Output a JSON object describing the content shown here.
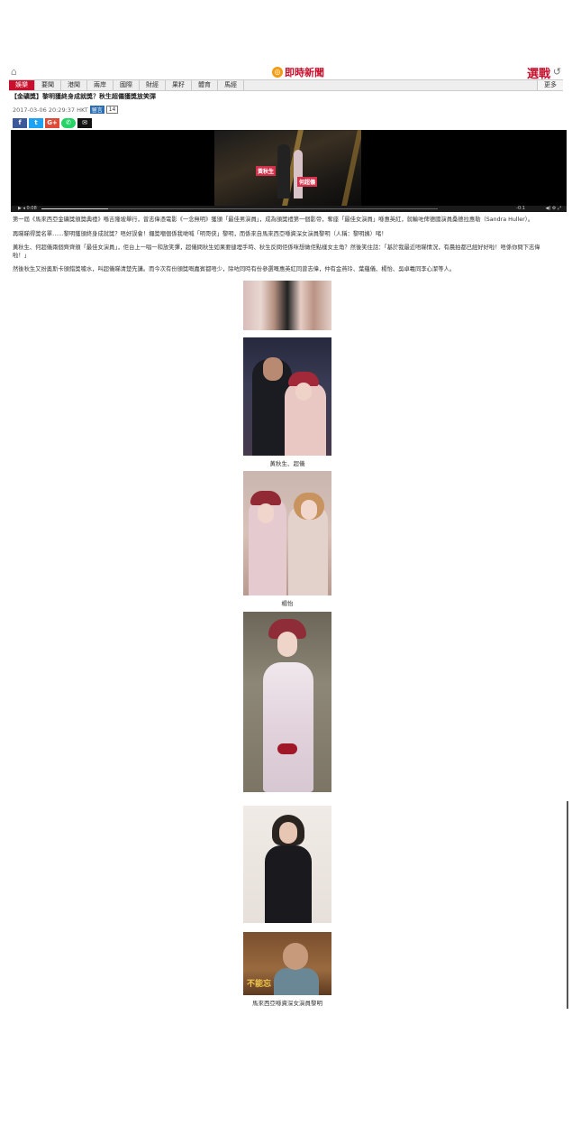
{
  "header": {
    "logo_text": "即時新聞",
    "brand_right": "選戰",
    "nav": [
      "娛樂",
      "要聞",
      "港聞",
      "兩岸",
      "國際",
      "財經",
      "果籽",
      "體育",
      "馬經"
    ],
    "more": "更多"
  },
  "article": {
    "headline": "【金礦獎】黎明獲終身成就獎？秋生超儀獲獎放笑彈",
    "timestamp": "2017-03-06 20:29:37 HKT",
    "comments_label": "留言",
    "comment_count": "14",
    "share_buttons": [
      "f",
      "t",
      "G+",
      "✆",
      "✉"
    ],
    "video": {
      "label_left": "黃秋生",
      "label_right": "何超儀",
      "time_current": "0:08",
      "time_total": "-0:1"
    },
    "paragraphs": [
      "第一屆《馬來西亞金礦獎頒獎典禮》喺吉隆坡舉行，曾志偉憑電影《一念無明》獲頒「最佳男演員」，成為頒獎禮第一個影帝，奪座「最佳女演員」喺惠英紅，就輸咗俾德國演員桑德拉惠勒（Sandra Huller）。",
      "再睇睇得獎名單……黎明獲頒終身成就獎？唔好誤會！攞獎嗰個係我哋喊「明哥俠」黎明，而係來自馬來西亞喺資深女演員黎明（人稱：黎明姨）啫！",
      "黃秋生、何超儀兩個齊齊頒「最佳女演員」，佢台上一唱一和放笑彈，超儀問秋生如果要撻埋手時、秋生反問佢係咪想做佢點樣女主角？然後笑住話：「基於我最近唔睇情況，有晨拍都已經好好啦！唔係你問下志偉啦！」",
      "然後秋生又扮奧斯卡頒錯獎噱水，叫超儀睇清楚先講。而今次有份頒獎嘅嘉賓都唔少，除咗同時有份參選嘅惠英紅同曾志偉，仲有金燕玲、葉蘊儀、楊怡、吳卓羲同李心潔等人。"
    ],
    "captions": [
      "黃秋生、超儀",
      "楊怡",
      "馬來西亞喺資深女演員黎明"
    ],
    "poster_text": "不能忘"
  }
}
